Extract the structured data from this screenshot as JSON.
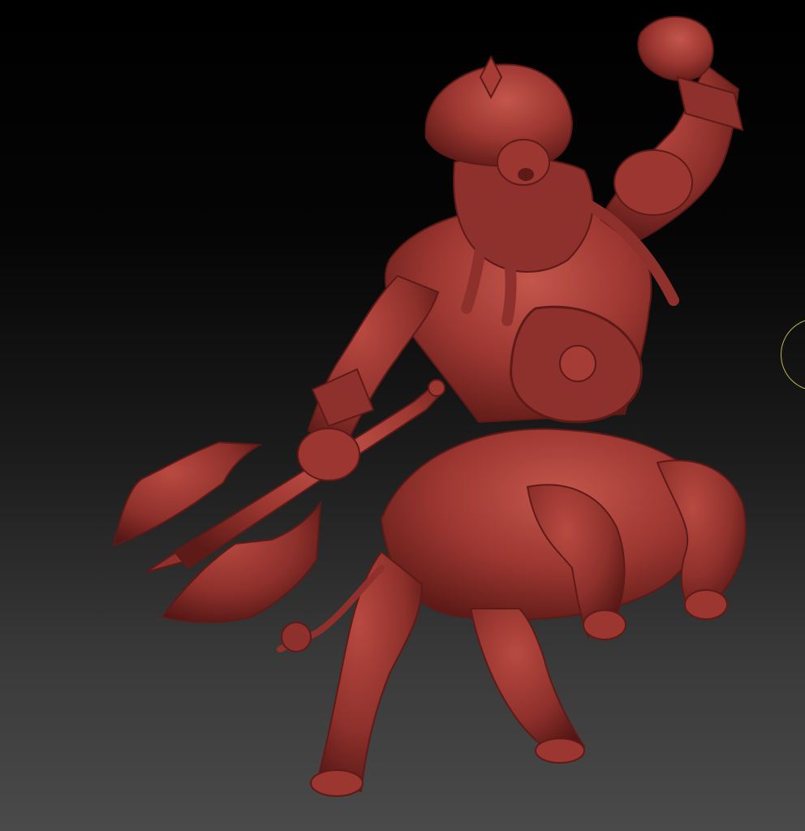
{
  "viewport": {
    "background_top_color": "#000000",
    "background_bottom_color": "#4a4a4a"
  },
  "model": {
    "subject": "centaur-warrior-sculpt",
    "material_color": "#9b3630",
    "shadow_color": "#5e1a17",
    "highlight_color": "#c4564c"
  },
  "brush_cursor": {
    "icon": "brush-circle-icon",
    "color": "#b9b64a"
  }
}
